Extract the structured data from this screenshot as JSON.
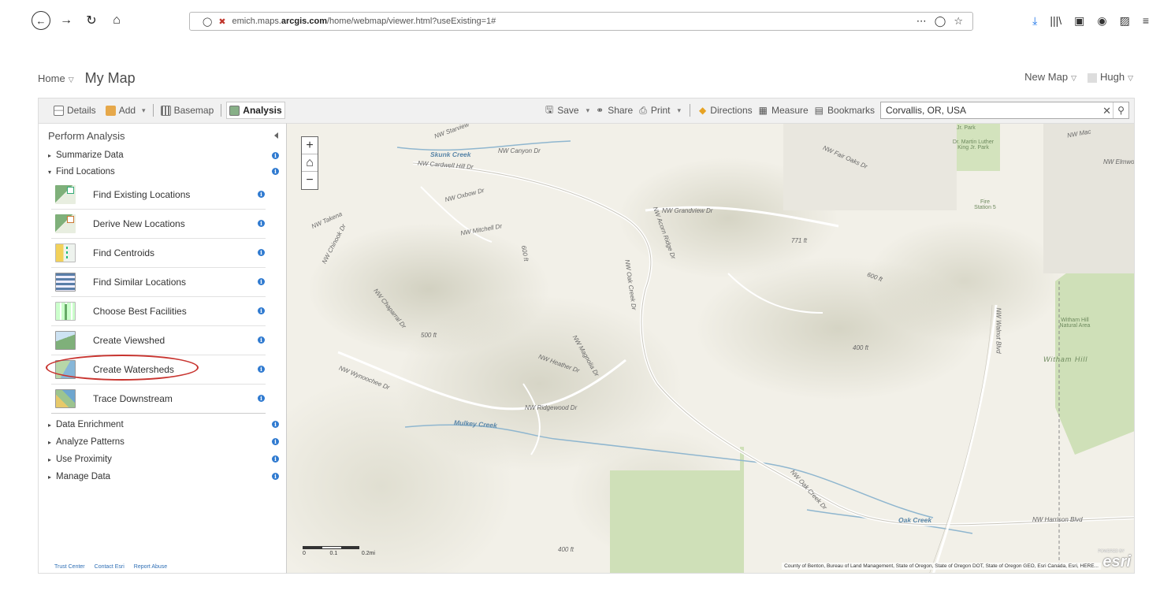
{
  "browser": {
    "url_prefix": "emich.maps.",
    "url_host": "arcgis.com",
    "url_path": "/home/webmap/viewer.html?useExisting=1#",
    "more_label": "⋯",
    "right_icons": [
      "⤓",
      "|||\\",
      "▣",
      "◉",
      "▨",
      "≡"
    ]
  },
  "header": {
    "home_label": "Home",
    "caret": "▽",
    "map_title": "My Map",
    "new_map_label": "New Map",
    "user_label": "Hugh"
  },
  "toolbar": {
    "details": "Details",
    "add": "Add",
    "basemap": "Basemap",
    "analysis": "Analysis",
    "save": "Save",
    "share": "Share",
    "print": "Print",
    "directions": "Directions",
    "measure": "Measure",
    "bookmarks": "Bookmarks",
    "dropdown_caret": "▾"
  },
  "search": {
    "value": "Corvallis, OR, USA",
    "clear": "✕"
  },
  "panel": {
    "title": "Perform Analysis",
    "categories_top": [
      {
        "label": "Summarize Data",
        "tri": "▸"
      },
      {
        "label": "Find Locations",
        "tri": "▾"
      }
    ],
    "tools": [
      {
        "label": "Find Existing Locations",
        "icon": "find-existing-locations-icon"
      },
      {
        "label": "Derive New Locations",
        "icon": "derive-new-locations-icon"
      },
      {
        "label": "Find Centroids",
        "icon": "find-centroids-icon"
      },
      {
        "label": "Find Similar Locations",
        "icon": "find-similar-locations-icon"
      },
      {
        "label": "Choose Best Facilities",
        "icon": "choose-best-facilities-icon"
      },
      {
        "label": "Create Viewshed",
        "icon": "create-viewshed-icon"
      },
      {
        "label": "Create Watersheds",
        "icon": "create-watersheds-icon"
      },
      {
        "label": "Trace Downstream",
        "icon": "trace-downstream-icon"
      }
    ],
    "categories_bottom": [
      {
        "label": "Data Enrichment",
        "tri": "▸"
      },
      {
        "label": "Analyze Patterns",
        "tri": "▸"
      },
      {
        "label": "Use Proximity",
        "tri": "▸"
      },
      {
        "label": "Manage Data",
        "tri": "▸"
      }
    ],
    "info_glyph": "i",
    "footer": {
      "trust_center": "Trust Center",
      "contact": "Contact Esri",
      "report": "Report Abuse"
    }
  },
  "map": {
    "zoom_in": "+",
    "zoom_out": "−",
    "home": "⌂",
    "labels": {
      "starview": "NW Starview",
      "skunk_creek": "Skunk Creek",
      "canyon": "NW Canyon Dr",
      "cardwell": "NW Cardwell Hill Dr",
      "oxbow": "NW Oxbow Dr",
      "mitchell": "NW Mitchell Dr",
      "takena": "NW Takena",
      "chinook": "NW Chinook Dr",
      "grandview": "NW Grandview Dr",
      "acorn": "NW Acorn Ridge Dr",
      "oak_creek_dr": "NW Oak Creek Dr",
      "chaparral": "NW Chaparral Dr",
      "magnolia": "NW Magnolia Dr",
      "heather": "NW Heather Dr",
      "wynoochee": "NW Wynoochee Dr",
      "ridgewood": "NW Ridgewood Dr",
      "mulkey": "Mulkey Creek",
      "oak_creek_dr_se": "NW Oak Creek Dr",
      "oak_creek": "Oak Creek",
      "harrison": "NW Harrison Blvd",
      "walnut": "NW Walnut Blvd",
      "fair_oaks": "NW Fair Oaks Dr",
      "mlk_park": "Dr. Martin Luther King Jr. Park",
      "jr_park": "Jr. Park",
      "fire_station": "Fire Station 5",
      "witham_area": "Witham Hill Natural Area",
      "witham_hill": "Witham Hill",
      "elmwood": "NW Elmwo",
      "ft771": "771 ft",
      "ft600a": "600 ft",
      "ft600b": "600 ft",
      "ft400a": "400 ft",
      "ft400b": "400 ft",
      "ft500": "500 ft",
      "nw_mac": "NW Mac"
    },
    "scale": [
      "0",
      "0.1",
      "0.2mi"
    ],
    "attribution": "County of Benton, Bureau of Land Management, State of Oregon, State of Oregon DOT, State of Oregon GEO, Esri Canada, Esri, HERE...",
    "esri_powered": "POWERED BY",
    "esri_logo": "esri"
  },
  "colors": {
    "accent": "#2f7ad0",
    "highlight": "#c8342f",
    "park": "#c9dcb0",
    "map_bg": "#f2f0e8"
  }
}
